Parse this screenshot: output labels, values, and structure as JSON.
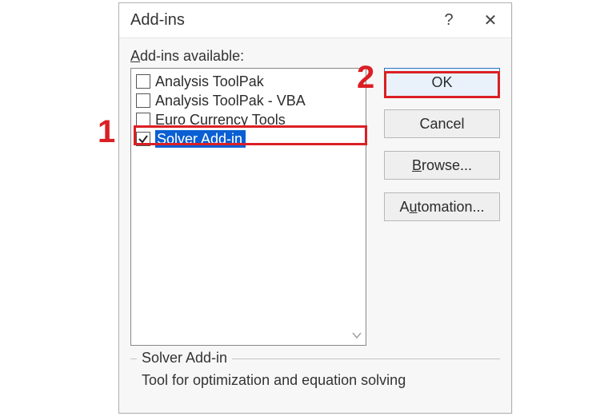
{
  "window": {
    "title": "Add-ins",
    "help_symbol": "?",
    "close_symbol": "✕"
  },
  "label_available_prefix": "A",
  "label_available_rest": "dd-ins available:",
  "addins": [
    {
      "name": "Analysis ToolPak",
      "checked": false,
      "selected": false
    },
    {
      "name": "Analysis ToolPak - VBA",
      "checked": false,
      "selected": false
    },
    {
      "name": "Euro Currency Tools",
      "checked": false,
      "selected": false
    },
    {
      "name": "Solver Add-in",
      "checked": true,
      "selected": true
    }
  ],
  "buttons": {
    "ok": "OK",
    "cancel": "Cancel",
    "browse_prefix": "B",
    "browse_mid": "rowse...",
    "automation_prefix": "A",
    "automation_u": "u",
    "automation_rest": "tomation..."
  },
  "description": {
    "title": "Solver Add-in",
    "text": "Tool for optimization and equation solving"
  },
  "annotations": {
    "n1": "1",
    "n2": "2"
  },
  "colors": {
    "selection": "#0a5fd3",
    "annotation": "#db1f24",
    "ok_border": "#2a72c7",
    "ok_bg": "#e9f2fb"
  }
}
